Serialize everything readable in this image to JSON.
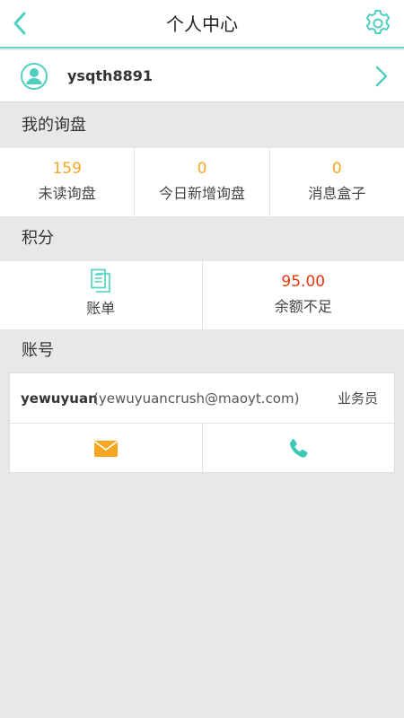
{
  "header": {
    "title": "个人中心",
    "back_icon": "chevron-left-icon",
    "settings_icon": "gear-icon",
    "accent_color": "#5dd6c6"
  },
  "user": {
    "username": "ysqth8891",
    "avatar_icon": "user-avatar-icon",
    "chevron_icon": "chevron-right-icon"
  },
  "inquiries": {
    "section_title": "我的询盘",
    "items": [
      {
        "value": "159",
        "label": "未读询盘"
      },
      {
        "value": "0",
        "label": "今日新增询盘"
      },
      {
        "value": "0",
        "label": "消息盒子"
      }
    ]
  },
  "points": {
    "section_title": "积分",
    "bill": {
      "label": "账单",
      "icon": "document-icon"
    },
    "balance": {
      "value": "95.00",
      "label": "余额不足",
      "color": "#e8380d"
    }
  },
  "account": {
    "section_title": "账号",
    "name": "yewuyuan",
    "email": "(yewuyuancrush@maoyt.com)",
    "role": "业务员",
    "mail_icon": "envelope-icon",
    "phone_icon": "phone-icon",
    "mail_color": "#f5a623",
    "phone_color": "#3cc8b4"
  }
}
